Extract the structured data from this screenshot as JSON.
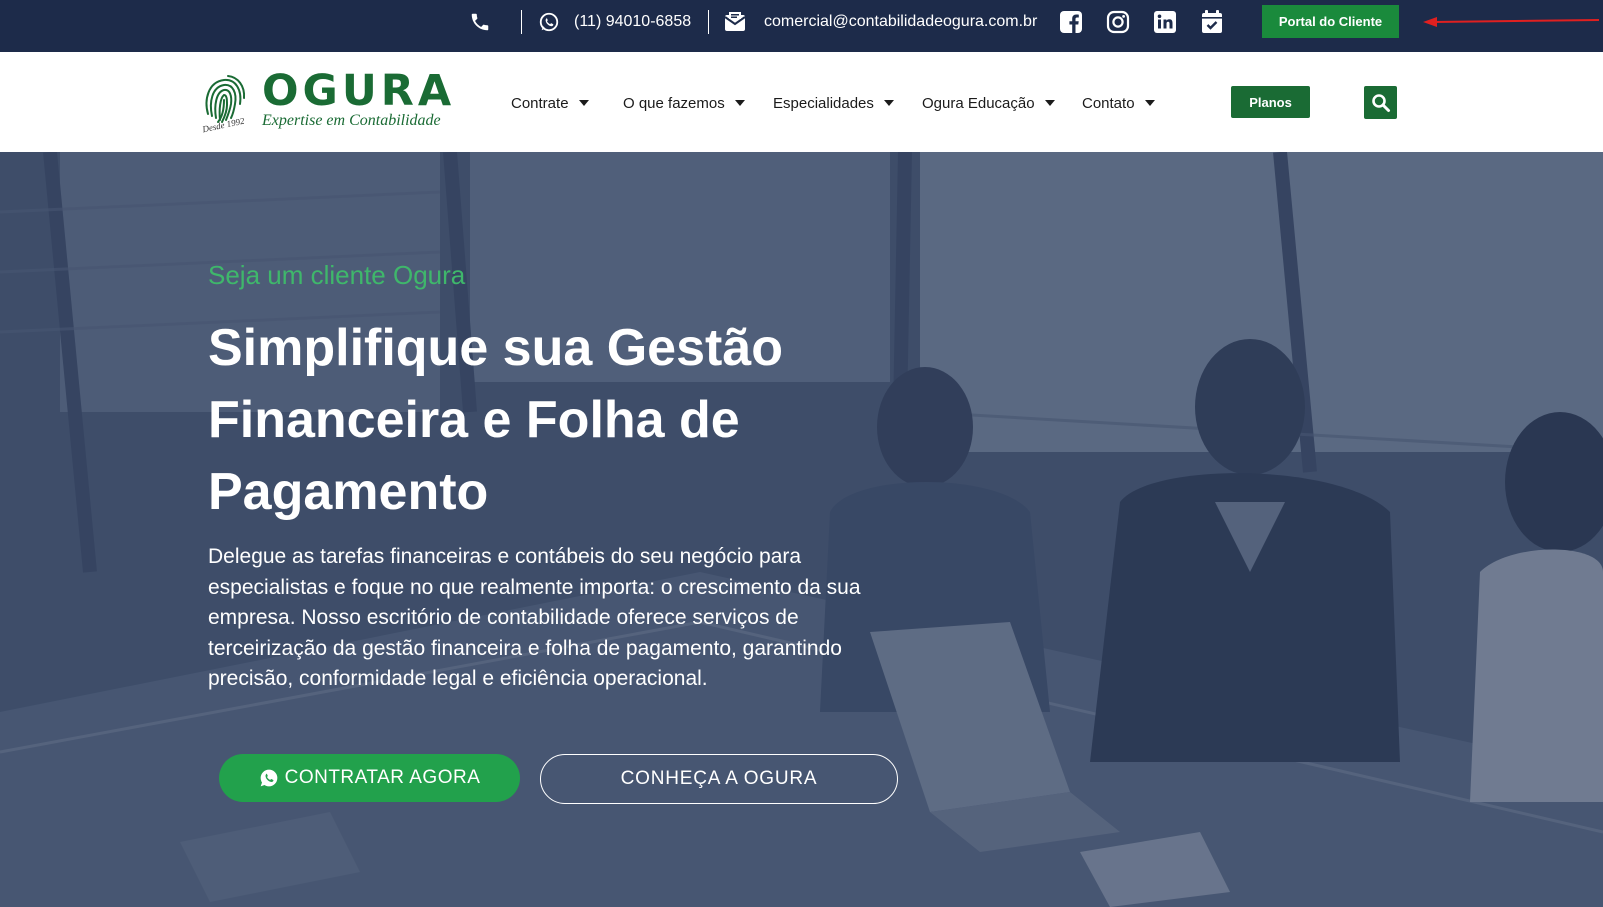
{
  "topbar": {
    "phone": "(11) 94010-6858",
    "email": "comercial@contabilidadeogura.com.br",
    "portal_button": "Portal do Cliente",
    "icons": [
      "phone-icon",
      "whatsapp-icon",
      "email-icon",
      "facebook-icon",
      "instagram-icon",
      "linkedin-icon",
      "calendar-icon"
    ]
  },
  "header": {
    "logo": {
      "wordmark": "OGURA",
      "tagline": "Expertise em Contabilidade",
      "since": "Desde 1992"
    },
    "nav": [
      {
        "label": "Contrate"
      },
      {
        "label": "O que fazemos"
      },
      {
        "label": "Especialidades"
      },
      {
        "label": "Ogura Educação"
      },
      {
        "label": "Contato"
      }
    ],
    "planos_button": "Planos"
  },
  "hero": {
    "eyebrow": "Seja um cliente Ogura",
    "title": "Simplifique sua Gestão Financeira e Folha de Pagamento",
    "body": "Delegue as tarefas financeiras e contábeis do seu negócio para especialistas e foque no que realmente importa: o crescimento da sua empresa. Nosso escritório de contabilidade oferece serviços de terceirização da gestão financeira e folha de pagamento, garantindo precisão, conformidade legal e eficiência operacional.",
    "cta_primary": "CONTRATAR AGORA",
    "cta_secondary": "CONHEÇA A OGURA"
  },
  "colors": {
    "topbar_bg": "#1d2b4a",
    "brand_green": "#1a6b34",
    "button_green": "#22a14c",
    "eyebrow_green": "#3fb76b",
    "annotation_red": "#e02020"
  }
}
